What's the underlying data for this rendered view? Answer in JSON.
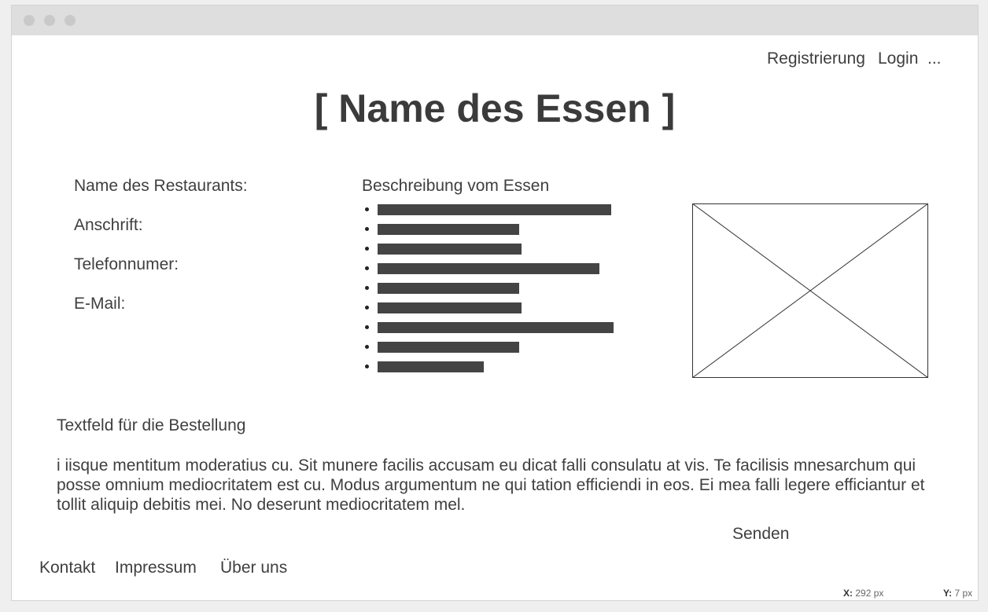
{
  "header": {
    "nav": [
      "Registrierung",
      "Login",
      "..."
    ],
    "title": "[ Name des Essen ]"
  },
  "info": {
    "restaurant_label": "Name des Restaurants:",
    "address_label": "Anschrift:",
    "phone_label": "Telefonnumer:",
    "email_label": "E-Mail:"
  },
  "description": {
    "heading": "Beschreibung vom Essen",
    "lines": [
      {
        "length": 0.99
      },
      {
        "length": 0.6
      },
      {
        "length": 0.61
      },
      {
        "length": 0.94
      },
      {
        "length": 0.6
      },
      {
        "length": 0.61
      },
      {
        "length": 1.0
      },
      {
        "length": 0.6
      },
      {
        "length": 0.45
      }
    ]
  },
  "order": {
    "heading": "Textfeld für die Bestellung",
    "text": "i iisque mentitum moderatius cu. Sit munere facilis accusam eu dicat falli consulatu at vis. Te facilisis mnesarchum qui posse omnium mediocritatem est cu. Modus argumentum ne qui tation efficiendi in eos. Ei mea falli legere efficiantur et tollit aliquip debitis mei. No deserunt mediocritatem mel.",
    "send_label": "Senden"
  },
  "footer": {
    "links": [
      "Kontakt",
      "Impressum",
      "Über uns"
    ]
  },
  "status": {
    "x_label": "X:",
    "x_value": "292 px",
    "y_label": "Y:",
    "y_value": "7 px"
  },
  "colors": {
    "bar": "#444444",
    "text": "#3f3f3f",
    "titlebar": "#dedede"
  },
  "icons": {
    "image_placeholder": "image-placeholder-icon"
  }
}
